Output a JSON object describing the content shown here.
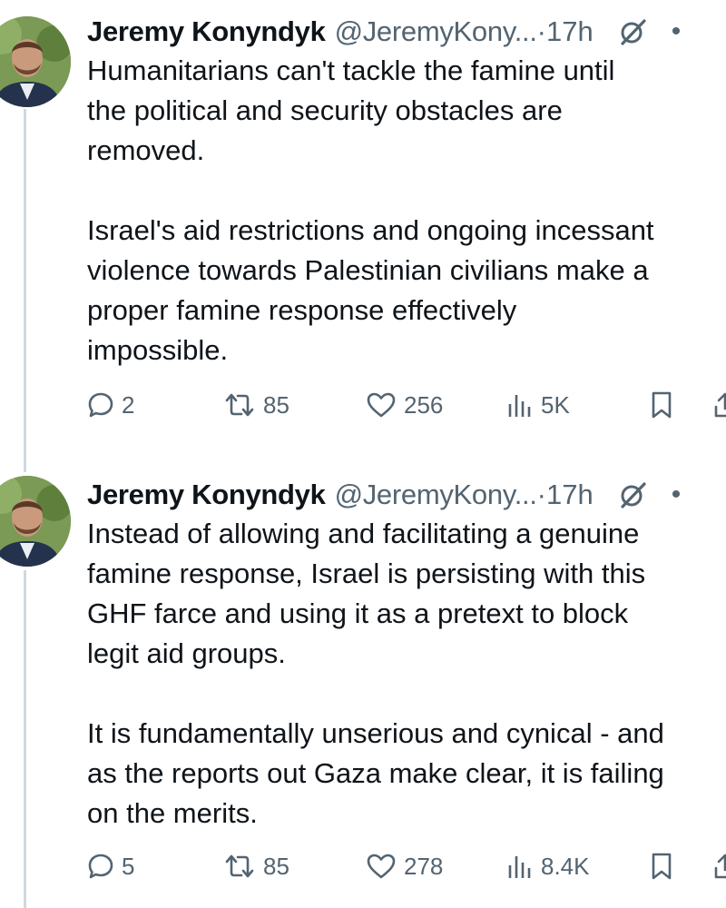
{
  "tweets": [
    {
      "author": {
        "name": "Jeremy Konyndyk",
        "handle": "@JeremyKony...",
        "time": "·17h"
      },
      "paragraphs": [
        [
          "Humanitarians can't tackle the famine until",
          "the political and security obstacles are",
          "removed."
        ],
        [
          "Israel's aid restrictions and ongoing incessant",
          "violence towards Palestinian civilians make a",
          "proper famine response effectively",
          "impossible."
        ]
      ],
      "stats": {
        "replies": "2",
        "reposts": "85",
        "likes": "256",
        "views": "5K"
      }
    },
    {
      "author": {
        "name": "Jeremy Konyndyk",
        "handle": "@JeremyKony...",
        "time": "·17h"
      },
      "paragraphs": [
        [
          "Instead of allowing and facilitating a genuine",
          "famine response, Israel is persisting with this",
          "GHF farce and using it as a pretext to block",
          "legit aid groups."
        ],
        [
          "It is fundamentally unserious and cynical - and",
          "as the reports out Gaza make clear, it is failing",
          "on the merits."
        ]
      ],
      "stats": {
        "replies": "5",
        "reposts": "85",
        "likes": "278",
        "views": "8.4K"
      }
    }
  ],
  "icons": {
    "reply": "speech-bubble-icon",
    "repost": "repost-arrows-icon",
    "like": "heart-icon",
    "views": "bar-chart-icon",
    "bookmark": "bookmark-icon",
    "share": "share-icon",
    "grok": "grok-slash-circle-icon",
    "more": "more-dots-icon"
  },
  "colors": {
    "text": "#0f1419",
    "secondary": "#536471",
    "thread_line": "#cfd9de",
    "background": "#ffffff"
  }
}
